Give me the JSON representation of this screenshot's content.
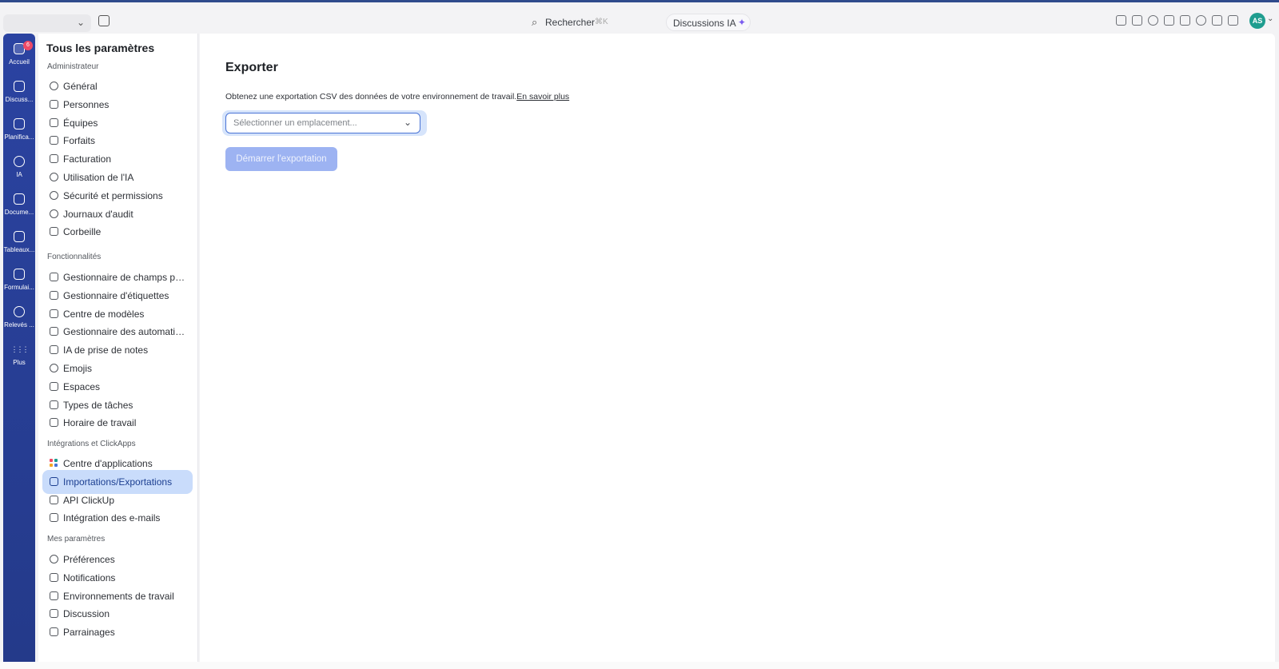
{
  "colors": {
    "rail_bg": "#2b43a1",
    "accent": "#4a74d6",
    "active_item_bg": "#c9dcfb",
    "button_disabled_bg": "#9db3f2",
    "badge": "#f04a66",
    "avatar_bg": "#1f9d8f"
  },
  "topbar": {
    "search_label": "Rechercher",
    "search_shortcut": "⌘K",
    "ai_button_label": "Discussions IA",
    "avatar_initials": "AS",
    "icons": [
      "check-edit-icon",
      "inbox-icon",
      "settings-icon",
      "notepad-icon",
      "video-icon",
      "microphone-icon",
      "alarm-icon",
      "document-icon"
    ]
  },
  "rail": {
    "items": [
      {
        "label": "Accueil",
        "icon": "home-icon",
        "badge": "6"
      },
      {
        "label": "Discuss...",
        "icon": "chat-icon"
      },
      {
        "label": "Planifica...",
        "icon": "calendar-icon"
      },
      {
        "label": "IA",
        "icon": "ai-icon"
      },
      {
        "label": "Docume...",
        "icon": "document-icon"
      },
      {
        "label": "Tableaux...",
        "icon": "dashboard-icon"
      },
      {
        "label": "Formulai...",
        "icon": "form-icon"
      },
      {
        "label": "Relevés ...",
        "icon": "clock-icon"
      },
      {
        "label": "Plus",
        "icon": "grid-icon"
      }
    ]
  },
  "settings": {
    "title": "Tous les paramètres",
    "sections": [
      {
        "heading": "Administrateur",
        "items": [
          {
            "label": "Général",
            "icon": "gear-icon"
          },
          {
            "label": "Personnes",
            "icon": "person-icon"
          },
          {
            "label": "Équipes",
            "icon": "teams-icon"
          },
          {
            "label": "Forfaits",
            "icon": "diamond-icon"
          },
          {
            "label": "Facturation",
            "icon": "credit-card-icon"
          },
          {
            "label": "Utilisation de l'IA",
            "icon": "ai-icon"
          },
          {
            "label": "Sécurité et permissions",
            "icon": "shield-icon"
          },
          {
            "label": "Journaux d'audit",
            "icon": "history-icon"
          },
          {
            "label": "Corbeille",
            "icon": "trash-icon"
          }
        ]
      },
      {
        "heading": "Fonctionnalités",
        "items": [
          {
            "label": "Gestionnaire de champs pers...",
            "icon": "edit-icon"
          },
          {
            "label": "Gestionnaire d'étiquettes",
            "icon": "tag-icon"
          },
          {
            "label": "Centre de modèles",
            "icon": "template-icon"
          },
          {
            "label": "Gestionnaire des automatisati...",
            "icon": "robot-icon"
          },
          {
            "label": "IA de prise de notes",
            "icon": "notetaker-icon"
          },
          {
            "label": "Emojis",
            "icon": "emoji-icon"
          },
          {
            "label": "Espaces",
            "icon": "rocket-icon"
          },
          {
            "label": "Types de tâches",
            "icon": "cube-icon"
          },
          {
            "label": "Horaire de travail",
            "icon": "calendar-clock-icon"
          }
        ]
      },
      {
        "heading": "Intégrations et ClickApps",
        "items": [
          {
            "label": "Centre d'applications",
            "icon": "apps-icon"
          },
          {
            "label": "Importations/Exportations",
            "icon": "import-export-icon",
            "active": true
          },
          {
            "label": "API ClickUp",
            "icon": "api-icon"
          },
          {
            "label": "Intégration des e-mails",
            "icon": "mail-icon"
          }
        ]
      },
      {
        "heading": "Mes paramètres",
        "items": [
          {
            "label": "Préférences",
            "icon": "preferences-icon"
          },
          {
            "label": "Notifications",
            "icon": "bell-icon"
          },
          {
            "label": "Environnements de travail",
            "icon": "workspace-icon"
          },
          {
            "label": "Discussion",
            "icon": "chat-icon"
          },
          {
            "label": "Parrainages",
            "icon": "referral-icon"
          }
        ]
      }
    ]
  },
  "main": {
    "title": "Exporter",
    "description": "Obtenez une exportation CSV des données de votre environnement de travail.",
    "learn_more": "En savoir plus",
    "location_placeholder": "Sélectionner un emplacement...",
    "start_button": "Démarrer l'exportation"
  }
}
